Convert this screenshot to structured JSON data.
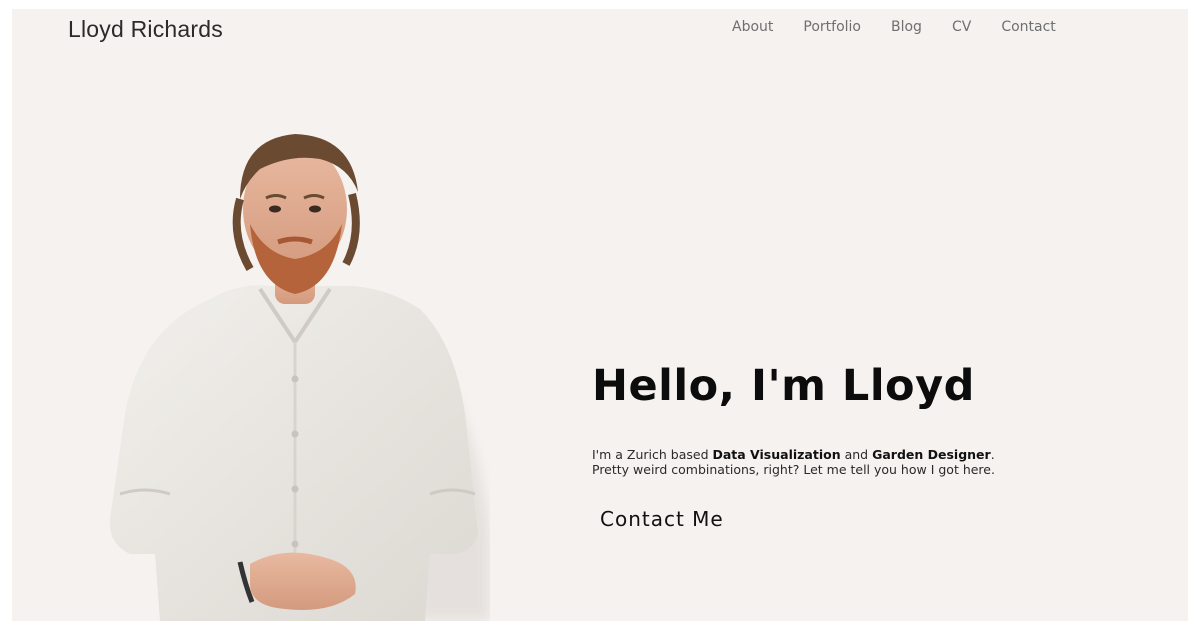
{
  "header": {
    "brand": "Lloyd Richards",
    "nav": [
      {
        "label": "About"
      },
      {
        "label": "Portfolio"
      },
      {
        "label": "Blog"
      },
      {
        "label": "CV"
      },
      {
        "label": "Contact"
      }
    ]
  },
  "hero": {
    "title": "Hello, I'm Lloyd",
    "intro_prefix": "I'm a Zurich based ",
    "role_1": "Data Visualization",
    "intro_mid": " and ",
    "role_2": "Garden Designer",
    "intro_suffix": ".",
    "line_2": "Pretty weird combinations, right? Let me tell you how I got here.",
    "cta_label": "Contact Me",
    "portrait_alt": "portrait-photo"
  },
  "colors": {
    "background": "#f5f2f0",
    "text": "#0c0c0c",
    "nav": "#6f6f6f"
  }
}
